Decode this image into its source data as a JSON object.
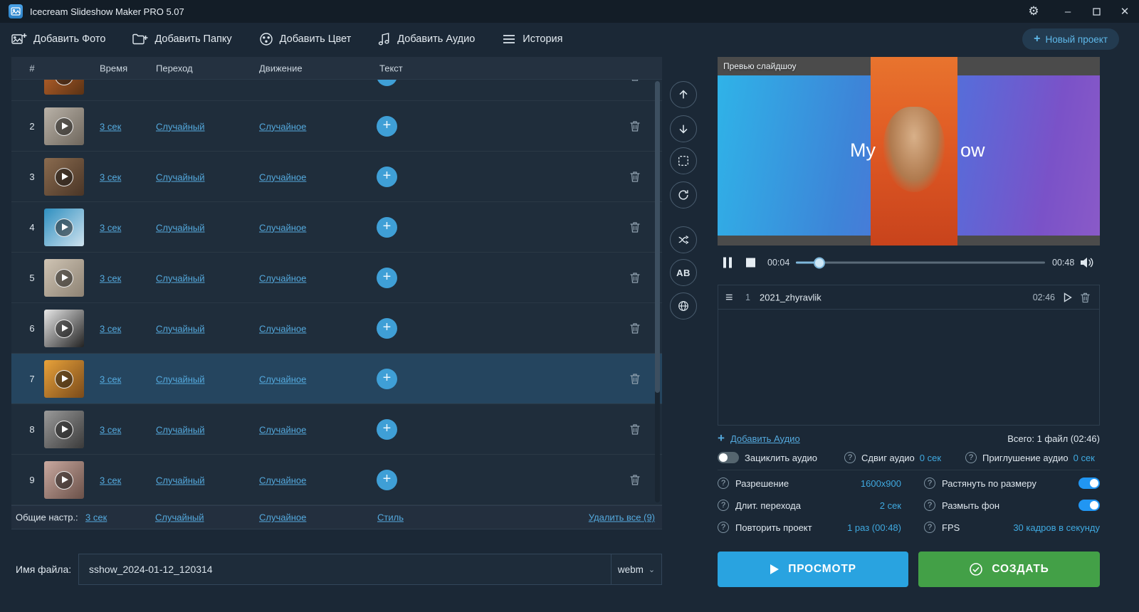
{
  "glyphs": {
    "plus": "+",
    "question": "?",
    "gear": "⚙",
    "minimize": "–",
    "close": "✕",
    "menu": "≡",
    "chevron_down": "⌄"
  },
  "titlebar": {
    "title": "Icecream Slideshow Maker PRO 5.07"
  },
  "toolbar": {
    "items": [
      {
        "label": "Добавить Фото"
      },
      {
        "label": "Добавить Папку"
      },
      {
        "label": "Добавить Цвет"
      },
      {
        "label": "Добавить Аудио"
      },
      {
        "label": "История"
      }
    ],
    "new_project": "Новый проект"
  },
  "table": {
    "headers": {
      "num": "#",
      "time": "Время",
      "transition": "Переход",
      "motion": "Движение",
      "text": "Текст"
    },
    "rows": [
      {
        "num": "",
        "time": "",
        "transition": "",
        "motion": "",
        "thumb": [
          "#c96a2e",
          "#5a3214"
        ],
        "partial": true,
        "selected": false
      },
      {
        "num": "2",
        "time": "3 сек",
        "transition": "Случайный",
        "motion": "Случайное",
        "thumb": [
          "#b9b2a8",
          "#6e665c"
        ],
        "partial": false,
        "selected": false
      },
      {
        "num": "3",
        "time": "3 сек",
        "transition": "Случайный",
        "motion": "Случайное",
        "thumb": [
          "#8a6b4f",
          "#4a3526"
        ],
        "partial": false,
        "selected": false
      },
      {
        "num": "4",
        "time": "3 сек",
        "transition": "Случайный",
        "motion": "Случайное",
        "thumb": [
          "#2e8fc0",
          "#cfe2ee"
        ],
        "partial": false,
        "selected": false
      },
      {
        "num": "5",
        "time": "3 сек",
        "transition": "Случайный",
        "motion": "Случайное",
        "thumb": [
          "#cfc4b4",
          "#8d8273"
        ],
        "partial": false,
        "selected": false
      },
      {
        "num": "6",
        "time": "3 сек",
        "transition": "Случайный",
        "motion": "Случайное",
        "thumb": [
          "#e8e8e8",
          "#222222"
        ],
        "partial": false,
        "selected": false
      },
      {
        "num": "7",
        "time": "3 сек",
        "transition": "Случайный",
        "motion": "Случайное",
        "thumb": [
          "#e8a23a",
          "#7a4a1a"
        ],
        "partial": false,
        "selected": true
      },
      {
        "num": "8",
        "time": "3 сек",
        "transition": "Случайный",
        "motion": "Случайное",
        "thumb": [
          "#9a9a9a",
          "#3a3a3a"
        ],
        "partial": false,
        "selected": false
      },
      {
        "num": "9",
        "time": "3 сек",
        "transition": "Случайный",
        "motion": "Случайное",
        "thumb": [
          "#c9a9a0",
          "#6a5048"
        ],
        "partial": false,
        "selected": false
      }
    ],
    "footer": {
      "label": "Общие настр.:",
      "time": "3 сек",
      "transition": "Случайный",
      "motion": "Случайное",
      "style": "Стиль",
      "delete_all": "Удалить все (9)"
    }
  },
  "filename": {
    "label": "Имя файла:",
    "value": "sshow_2024-01-12_120314",
    "format": "webm"
  },
  "sidebar": {
    "ab_label": "AB"
  },
  "preview": {
    "label": "Превью слайдшоу",
    "text_left": "My",
    "text_right": "ow",
    "current_time": "00:04",
    "total_time": "00:48"
  },
  "audio": {
    "track": {
      "index": "1",
      "name": "2021_zhyravlik",
      "duration": "02:46"
    },
    "add_label": "Добавить Аудио",
    "total": "Всего: 1 файл (02:46)",
    "loop_label": "Зациклить аудио",
    "shift_label": "Сдвиг аудио",
    "shift_value": "0 сек",
    "fade_label": "Приглушение аудио",
    "fade_value": "0 сек"
  },
  "settings": {
    "resolution_label": "Разрешение",
    "resolution_value": "1600x900",
    "stretch_label": "Растянуть по размеру",
    "transition_label": "Длит. перехода",
    "transition_value": "2 сек",
    "blur_label": "Размыть фон",
    "repeat_label": "Повторить проект",
    "repeat_value": "1 раз (00:48)",
    "fps_label": "FPS",
    "fps_value": "30 кадров в секунду"
  },
  "actions": {
    "preview": "ПРОСМОТР",
    "create": "СОЗДАТЬ"
  },
  "colors": {
    "accent": "#54a9dd",
    "value_blue": "#3fa9e0",
    "toggle_on": "#2196f3",
    "preview_button": "#29a3e0",
    "create_button": "#43a047"
  }
}
